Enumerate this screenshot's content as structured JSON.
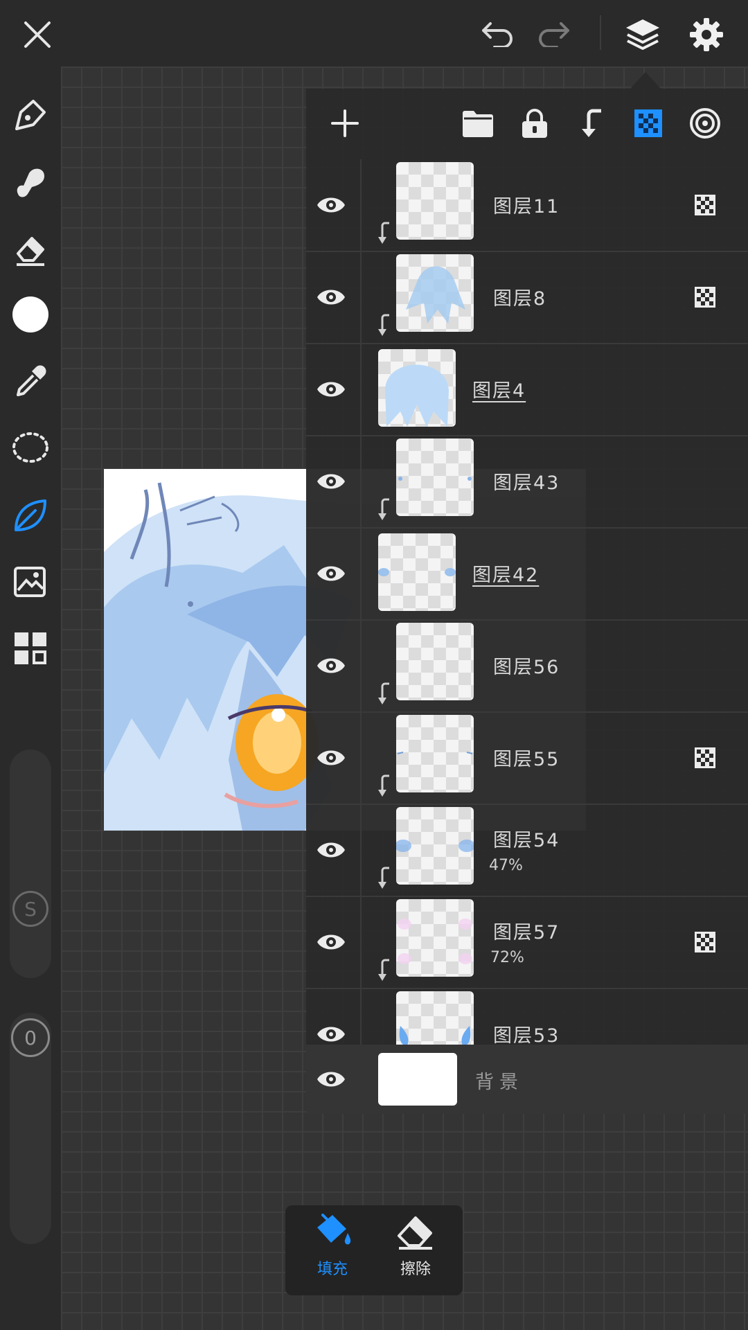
{
  "topbar": {
    "close_icon": "close-icon",
    "undo_icon": "undo-icon",
    "redo_icon": "redo-icon",
    "layers_icon": "layers-icon",
    "settings_icon": "gear-icon"
  },
  "sidebar": {
    "tools": [
      "pen-tool",
      "smudge-tool",
      "eraser-tool",
      "color-picker",
      "eyedropper-tool",
      "lasso-tool",
      "leaf-tool",
      "import-image-tool",
      "gallery-tool"
    ],
    "active_tool": "leaf-tool",
    "size_slider_label": "S",
    "opacity_slider_label": "0"
  },
  "panel": {
    "toolbar_icons": [
      "add-icon",
      "folder-icon",
      "lock-icon",
      "clip-icon",
      "alpha-lock-icon",
      "target-icon"
    ],
    "layers": [
      {
        "name": "图层11",
        "opacity": "",
        "clipped": true,
        "alpha_lock": true,
        "selected": false
      },
      {
        "name": "图层8",
        "opacity": "",
        "clipped": true,
        "alpha_lock": true,
        "selected": false
      },
      {
        "name": "图层4",
        "opacity": "",
        "clipped": false,
        "alpha_lock": false,
        "selected": true
      },
      {
        "name": "图层43",
        "opacity": "",
        "clipped": true,
        "alpha_lock": false,
        "selected": false
      },
      {
        "name": "图层42",
        "opacity": "",
        "clipped": false,
        "alpha_lock": false,
        "selected": true
      },
      {
        "name": "图层56",
        "opacity": "",
        "clipped": true,
        "alpha_lock": false,
        "selected": false
      },
      {
        "name": "图层55",
        "opacity": "",
        "clipped": true,
        "alpha_lock": true,
        "selected": false
      },
      {
        "name": "图层54",
        "opacity": "47%",
        "clipped": true,
        "alpha_lock": false,
        "selected": false
      },
      {
        "name": "图层57",
        "opacity": "72%",
        "clipped": true,
        "alpha_lock": true,
        "selected": false
      },
      {
        "name": "图层53",
        "opacity": "",
        "clipped": false,
        "alpha_lock": false,
        "selected": false
      }
    ],
    "background_layer": {
      "name": "背景"
    }
  },
  "bottom_bar": {
    "fill_label": "填充",
    "erase_label": "擦除"
  },
  "colors": {
    "accent": "#1e90ff",
    "panel_bg": "#2a2a2a"
  }
}
